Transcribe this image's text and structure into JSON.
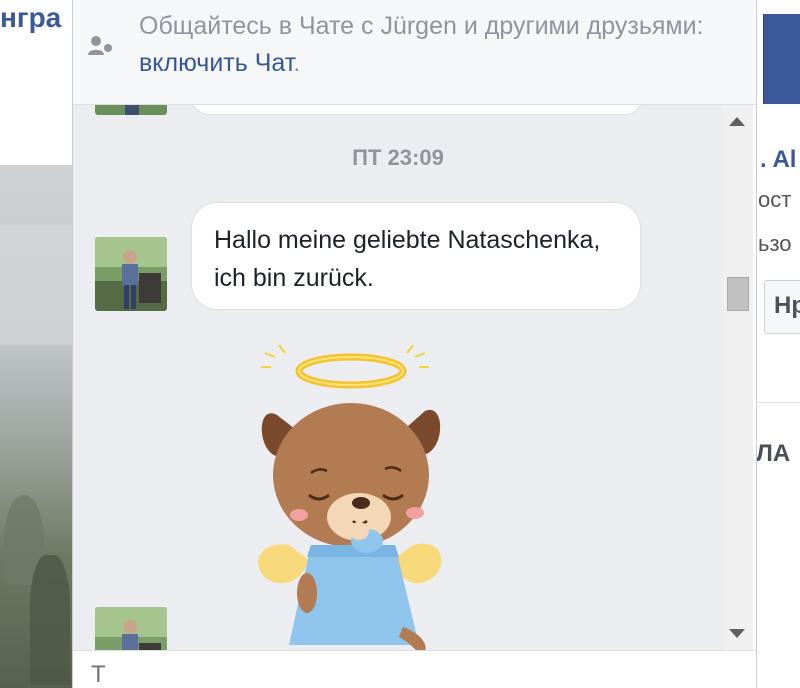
{
  "background": {
    "left_title": "нгра",
    "right_name": ". Al",
    "right_line1": "ост",
    "right_line2": "ьзо",
    "right_button": "Hp",
    "right_section": "ЛА"
  },
  "chat": {
    "notice": {
      "text": "Общайтесь в Чате с Jürgen и другими друзьями: ",
      "link": "включить Чат",
      "suffix": ".",
      "icon": "person-offline-icon"
    },
    "timestamp": "ПТ 23:09",
    "message": {
      "text": "Hallo meine geliebte Nataschenka, ich bin zurück."
    },
    "sticker": {
      "icon": "angel-puppy-sticker"
    },
    "composer": {
      "placeholder": "Т"
    },
    "colors": {
      "link": "#365899",
      "bubble": "#ffffff",
      "thread_bg": "#ebedf0",
      "muted": "#90949c"
    }
  }
}
